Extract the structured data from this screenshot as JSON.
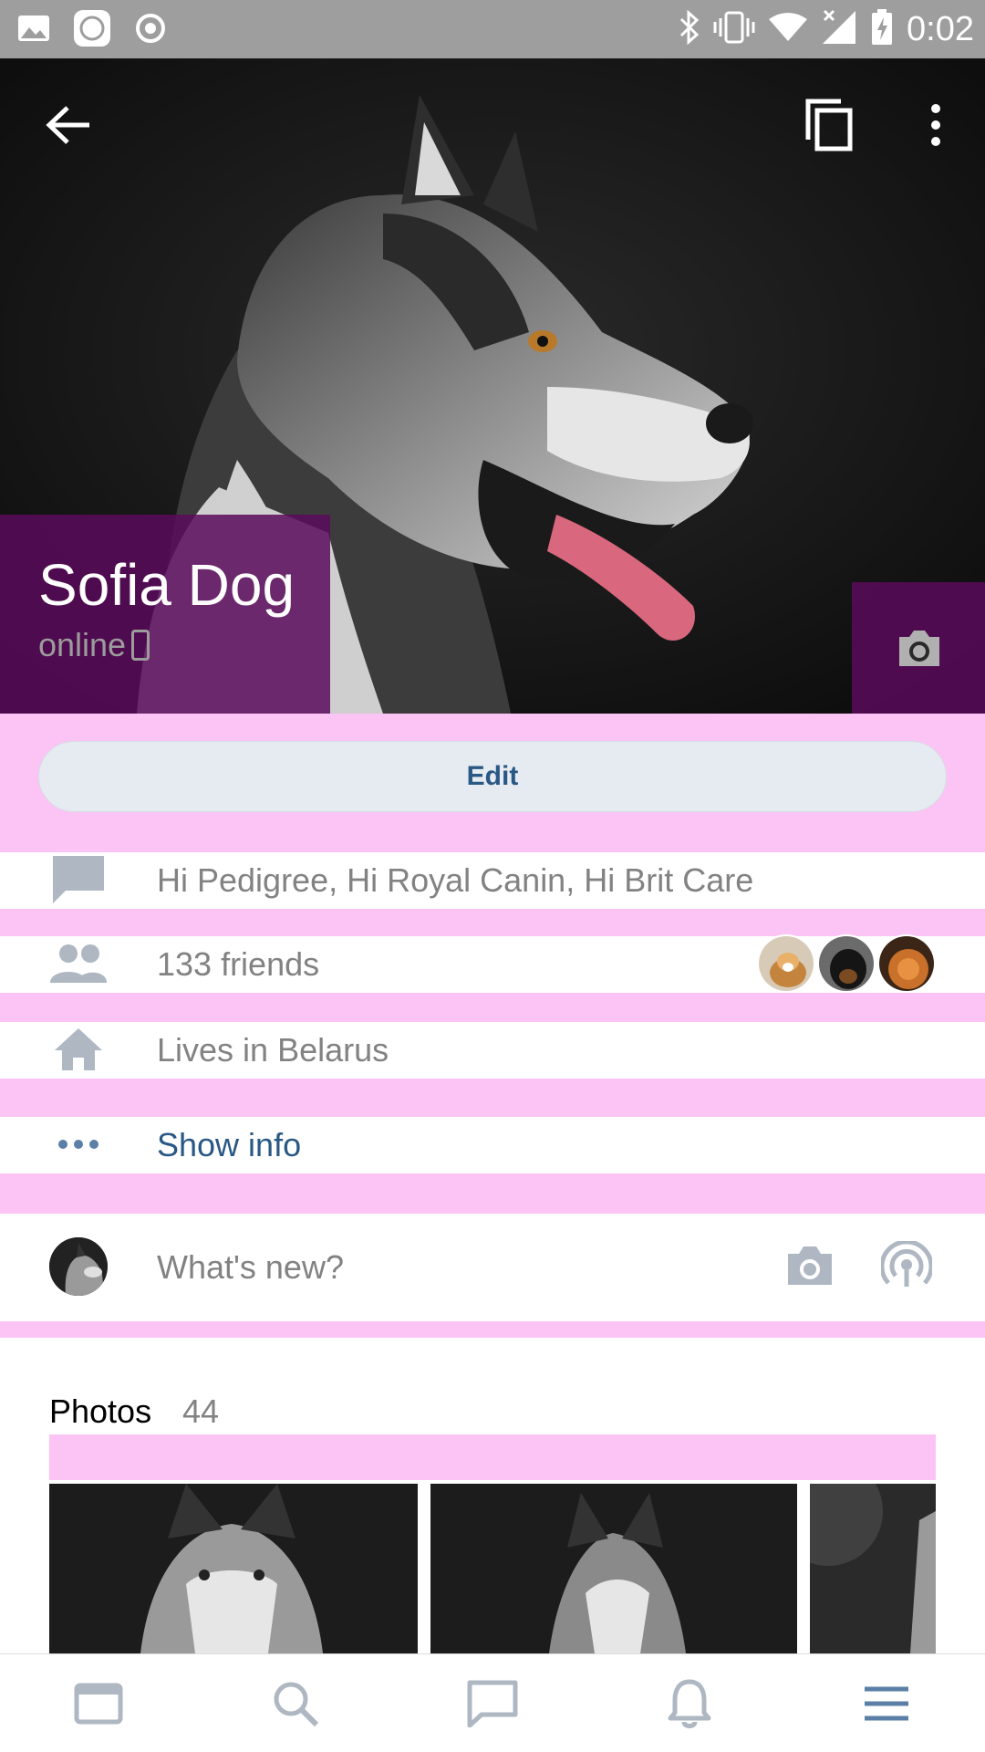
{
  "status_bar": {
    "time": "0:02",
    "left_icons": [
      "gallery-icon",
      "mi-icon",
      "record-icon"
    ],
    "right_icons": [
      "bluetooth-icon",
      "vibrate-icon",
      "wifi-icon",
      "signal-off-icon",
      "battery-charging-icon"
    ]
  },
  "profile": {
    "name": "Sofia Dog",
    "status": "online",
    "edit_label": "Edit"
  },
  "info_rows": [
    {
      "icon": "status-bubble-icon",
      "text": "Hi Pedigree, Hi Royal Canin, Hi Brit Care"
    },
    {
      "icon": "friends-icon",
      "text": "133 friends"
    },
    {
      "icon": "home-icon",
      "text": "Lives in Belarus"
    },
    {
      "icon": "more-dots-icon",
      "text": "Show info"
    }
  ],
  "post_box": {
    "placeholder": "What's new?"
  },
  "photos": {
    "title": "Photos",
    "count": "44"
  },
  "tabs": [
    "news-icon",
    "search-icon",
    "messages-icon",
    "notifications-icon",
    "menu-icon"
  ],
  "colors": {
    "accent": "#2a5885",
    "secondary_text": "#828282",
    "overlay": "#5a0a5a",
    "icon_gray": "#aeb7c2"
  }
}
